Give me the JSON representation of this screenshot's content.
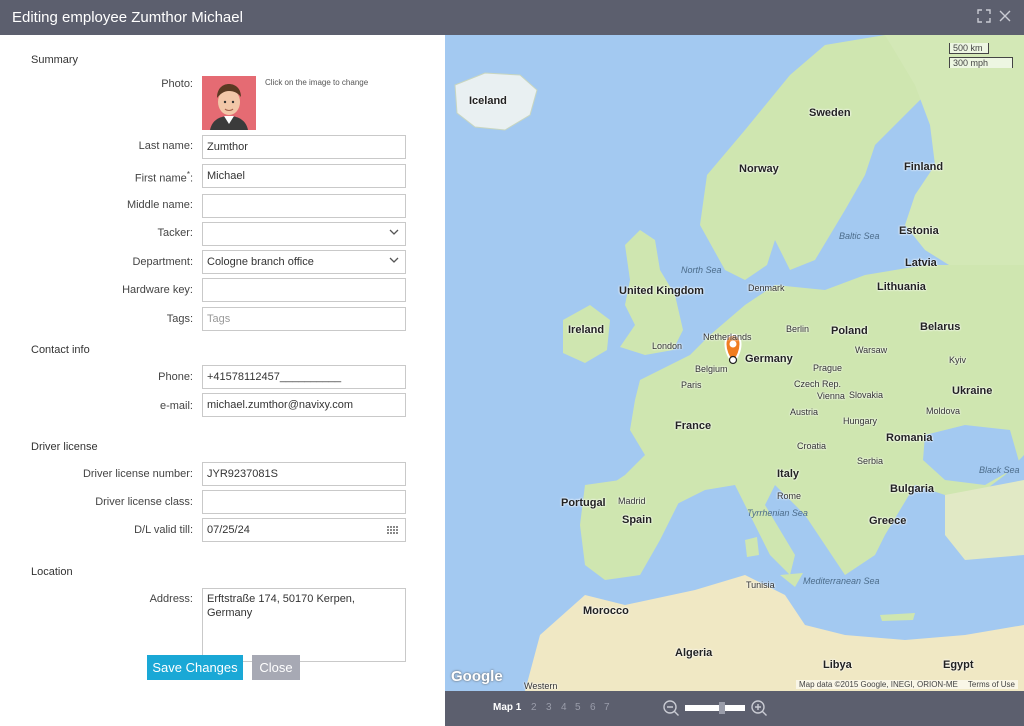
{
  "window": {
    "title": "Editing employee Zumthor Michael"
  },
  "sections": {
    "summary": "Summary",
    "contact": "Contact info",
    "license": "Driver license",
    "location": "Location"
  },
  "summary": {
    "photo_label": "Photo:",
    "photo_hint": "Click on the image to change",
    "last_name_label": "Last name:",
    "last_name_value": "Zumthor",
    "first_name_label": "First name",
    "first_name_required": "*",
    "first_name_colon": ":",
    "first_name_value": "Michael",
    "middle_name_label": "Middle name:",
    "middle_name_value": "",
    "tracker_label": "Tacker:",
    "tracker_value": "",
    "department_label": "Department:",
    "department_value": "Cologne branch office",
    "hardware_key_label": "Hardware key:",
    "hardware_key_value": "",
    "tags_label": "Tags:",
    "tags_placeholder": "Tags"
  },
  "contact": {
    "phone_label": "Phone:",
    "phone_value": "+41578112457__________",
    "email_label": "e-mail:",
    "email_value": "michael.zumthor@navixy.com"
  },
  "license": {
    "number_label": "Driver license number:",
    "number_value": "JYR9237081S",
    "class_label": "Driver license class:",
    "class_value": "",
    "valid_label": "D/L valid till:",
    "valid_value": "07/25/24"
  },
  "location": {
    "address_label": "Address:",
    "address_value": "Erftstraße 174, 50170 Kerpen, Germany"
  },
  "buttons": {
    "save": "Save Changes",
    "close": "Close"
  },
  "map": {
    "scale_km": "500 km",
    "scale_mi": "300 mph",
    "google": "Google",
    "attribution": "Map data ©2015 Google, INEGI, ORION-ME",
    "terms": "Terms of Use",
    "countries": [
      "Iceland",
      "Sweden",
      "Norway",
      "Finland",
      "Estonia",
      "Latvia",
      "Lithuania",
      "Denmark",
      "United Kingdom",
      "Ireland",
      "Netherlands",
      "Belgium",
      "Germany",
      "Poland",
      "Belarus",
      "Ukraine",
      "France",
      "Czech Rep.",
      "Slovakia",
      "Austria",
      "Hungary",
      "Moldova",
      "Romania",
      "Croatia",
      "Serbia",
      "Bulgaria",
      "Italy",
      "Portugal",
      "Spain",
      "Greece",
      "Tunisia",
      "Morocco",
      "Algeria",
      "Libya",
      "Egypt",
      "Western"
    ],
    "cities": [
      "London",
      "Berlin",
      "Warsaw",
      "Paris",
      "Prague",
      "Vienna",
      "Madrid",
      "Rome",
      "Kyiv"
    ],
    "seas": [
      "North Sea",
      "Baltic Sea",
      "Black Sea",
      "Tyrrhenian Sea",
      "Mediterranean Sea"
    ],
    "tabs": [
      "Map 1",
      "2",
      "3",
      "4",
      "5",
      "6",
      "7"
    ],
    "active_tab": 0,
    "zoom_level_fraction": 0.6,
    "marker_color": "#f07c1f"
  },
  "colors": {
    "accent": "#1aa8d6",
    "titlebar": "#5c5f6e",
    "water": "#a3c9f1",
    "land": "#cfe6b0"
  }
}
